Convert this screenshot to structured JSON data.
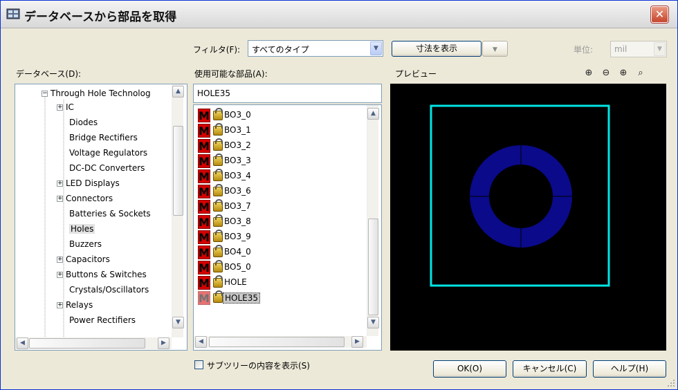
{
  "window": {
    "title": "データベースから部品を取得",
    "close_label": "✕"
  },
  "filter": {
    "label": "フィルタ(F):",
    "value": "すべてのタイプ"
  },
  "dimensions_button": "寸法を表示",
  "unit": {
    "label": "単位:",
    "value": "mil"
  },
  "database": {
    "label": "データベース(D):",
    "root": "Through Hole Technolog",
    "items": [
      {
        "label": "IC",
        "expandable": true
      },
      {
        "label": "Diodes",
        "expandable": false
      },
      {
        "label": "Bridge Rectifiers",
        "expandable": false
      },
      {
        "label": "Voltage Regulators",
        "expandable": false
      },
      {
        "label": "DC-DC Converters",
        "expandable": false
      },
      {
        "label": "LED Displays",
        "expandable": true
      },
      {
        "label": "Connectors",
        "expandable": true
      },
      {
        "label": "Batteries & Sockets",
        "expandable": false
      },
      {
        "label": "Holes",
        "expandable": false
      },
      {
        "label": "Buzzers",
        "expandable": false
      },
      {
        "label": "Capacitors",
        "expandable": true
      },
      {
        "label": "Buttons & Switches",
        "expandable": true
      },
      {
        "label": "Crystals/Oscillators",
        "expandable": false
      },
      {
        "label": "Relays",
        "expandable": true
      },
      {
        "label": "Power Rectifiers",
        "expandable": false
      }
    ]
  },
  "parts": {
    "label": "使用可能な部品(A):",
    "search_value": "HOLE35",
    "items": [
      "BO3_0",
      "BO3_1",
      "BO3_2",
      "BO3_3",
      "BO3_4",
      "BO3_6",
      "BO3_7",
      "BO3_8",
      "BO3_9",
      "BO4_0",
      "BO5_0",
      "HOLE",
      "HOLE35"
    ],
    "selected": "HOLE35",
    "icon_letter": "M"
  },
  "preview": {
    "label": "プレビュー",
    "outline_color": "#00e5e5",
    "pad_color": "#0a0a8a"
  },
  "show_subtree": {
    "label": "サブツリーの内容を表示(S)",
    "checked": false
  },
  "buttons": {
    "ok": "OK(O)",
    "cancel": "キャンセル(C)",
    "help": "ヘルプ(H)"
  },
  "colors": {
    "accent": "#0831d9",
    "background": "#ece9d8"
  }
}
